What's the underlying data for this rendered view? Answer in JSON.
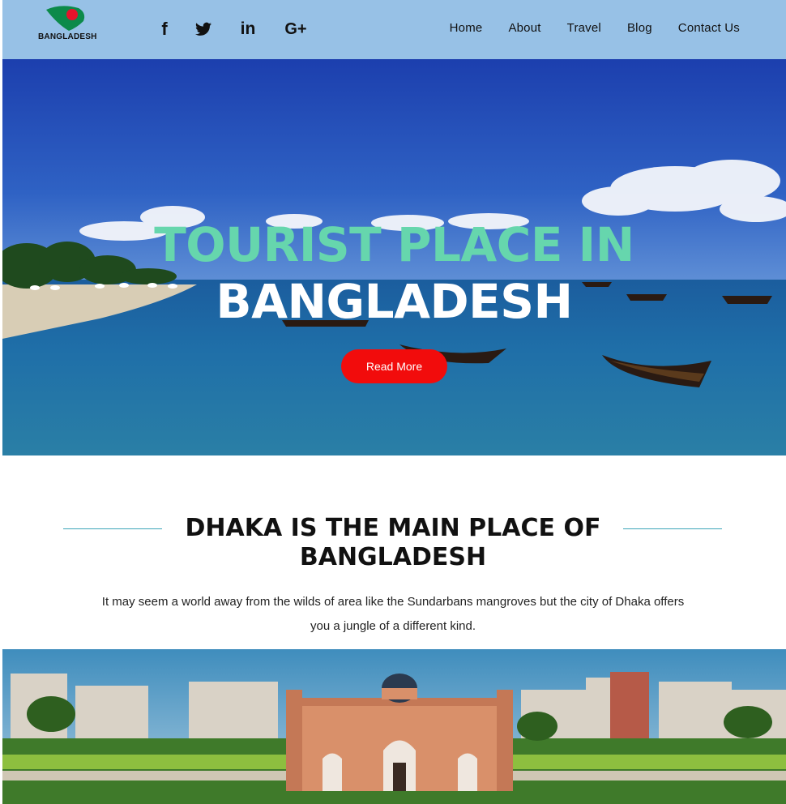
{
  "header": {
    "logo_text": "BANGLADESH",
    "social": [
      {
        "name": "facebook",
        "glyph": "f"
      },
      {
        "name": "twitter",
        "glyph": "🐦"
      },
      {
        "name": "linkedin",
        "glyph": "in"
      },
      {
        "name": "google-plus",
        "glyph": "G+"
      }
    ],
    "nav": [
      "Home",
      "About",
      "Travel",
      "Blog",
      "Contact Us"
    ]
  },
  "hero": {
    "title_line1": "TOURIST PLACE IN",
    "title_line2": "BANGLADESH",
    "button_label": "Read More"
  },
  "section": {
    "title_line1": "DHAKA IS THE MAIN PLACE OF",
    "title_line2": "BANGLADESH",
    "description_line1": "It may seem a world away from the wilds of area like the Sundarbans mangroves but the city of Dhaka offers",
    "description_line2": "you a jungle of a different kind."
  },
  "colors": {
    "header_bg": "#97c1e6",
    "accent_green": "#66d6ad",
    "button_red": "#f20c0c",
    "rule": "#3ca6b8"
  }
}
